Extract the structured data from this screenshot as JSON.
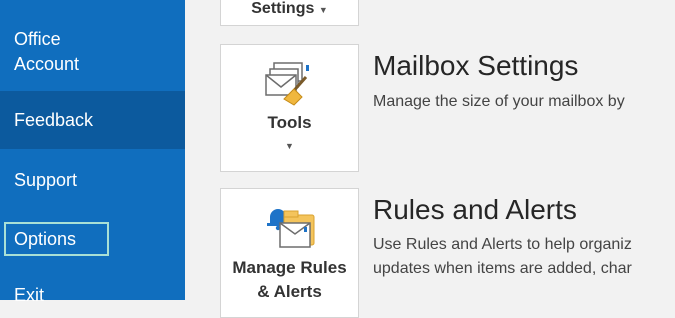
{
  "nav": {
    "office_account_line1": "Office",
    "office_account_line2": "Account",
    "feedback": "Feedback",
    "support": "Support",
    "options": "Options",
    "exit": "Exit"
  },
  "tiles": {
    "settings_label": "Settings",
    "tools_label": "Tools",
    "rules_label_line1": "Manage Rules",
    "rules_label_line2": "& Alerts"
  },
  "sections": {
    "mailbox_title": "Mailbox Settings",
    "mailbox_desc": "Manage the size of your mailbox by",
    "rules_title": "Rules and Alerts",
    "rules_desc_line1": "Use Rules and Alerts to help organiz",
    "rules_desc_line2": "updates when items are added, char"
  },
  "colors": {
    "nav_bg": "#106ebe",
    "nav_selected": "#0c5a9e",
    "focus_border": "#a8e0d6"
  },
  "icons": [
    "envelope-stack-broom-icon",
    "bell-folder-envelope-icon",
    "caret-down-icon"
  ]
}
